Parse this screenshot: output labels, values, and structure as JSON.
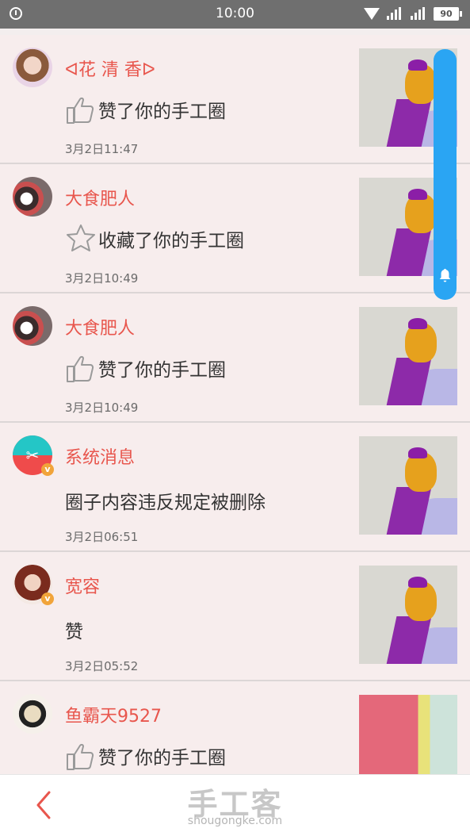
{
  "status_bar": {
    "time": "10:00",
    "battery": "90"
  },
  "notifications": [
    {
      "name": "ᐊ花 清 香ᐅ",
      "action": "赞了你的手工圈",
      "action_icon": "thumbs-up-icon",
      "time": "3月2日11:47"
    },
    {
      "name": "大食肥人",
      "action": "收藏了你的手工圈",
      "action_icon": "star-icon",
      "time": "3月2日10:49"
    },
    {
      "name": "大食肥人",
      "action": "赞了你的手工圈",
      "action_icon": "thumbs-up-icon",
      "time": "3月2日10:49"
    },
    {
      "name": "系统消息",
      "action": "圈子内容违反规定被删除",
      "time": "3月2日06:51"
    },
    {
      "name": "宽容",
      "action": "赞",
      "time": "3月2日05:52"
    },
    {
      "name": "鱼霸天9527",
      "action": "赞了你的手工圈",
      "action_icon": "thumbs-up-icon"
    }
  ],
  "bottom_bar": {
    "logo": "手工客",
    "logo_sub": "shougongke.com",
    "back_icon": "chevron-left-icon"
  },
  "colors": {
    "name": "#e8564d",
    "accent": "#2aa5f3",
    "background": "#f7eded"
  }
}
